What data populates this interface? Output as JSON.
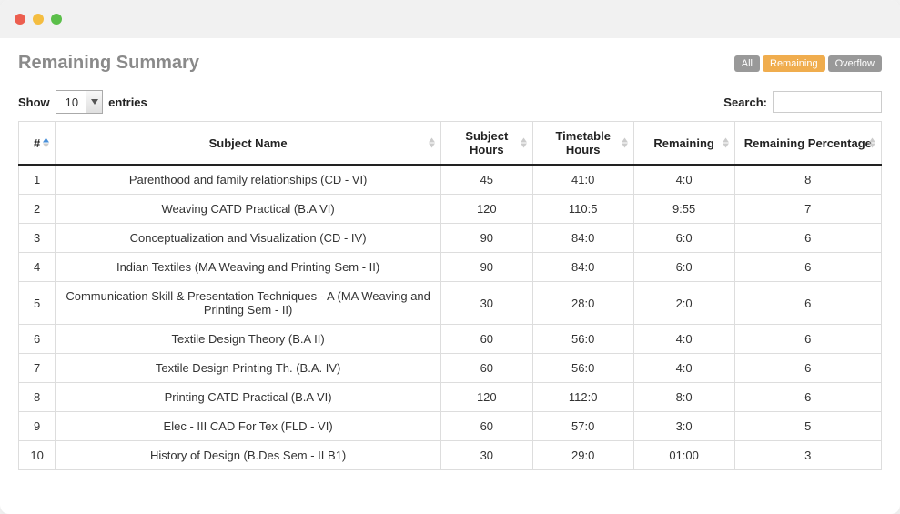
{
  "header": {
    "title": "Remaining Summary",
    "filters": {
      "all": "All",
      "remaining": "Remaining",
      "overflow": "Overflow"
    }
  },
  "controls": {
    "show_label": "Show",
    "entries_label": "entries",
    "entries_value": "10",
    "search_label": "Search:",
    "search_value": ""
  },
  "table": {
    "columns": {
      "num": "#",
      "subject": "Subject Name",
      "subject_hours": "Subject Hours",
      "timetable_hours": "Timetable Hours",
      "remaining": "Remaining",
      "remaining_pct": "Remaining Percentage"
    },
    "rows": [
      {
        "num": "1",
        "subject": "Parenthood and family relationships (CD - VI)",
        "subject_hours": "45",
        "timetable_hours": "41:0",
        "remaining": "4:0",
        "pct": "8"
      },
      {
        "num": "2",
        "subject": "Weaving CATD Practical (B.A VI)",
        "subject_hours": "120",
        "timetable_hours": "110:5",
        "remaining": "9:55",
        "pct": "7"
      },
      {
        "num": "3",
        "subject": "Conceptualization and Visualization (CD - IV)",
        "subject_hours": "90",
        "timetable_hours": "84:0",
        "remaining": "6:0",
        "pct": "6"
      },
      {
        "num": "4",
        "subject": "Indian Textiles (MA Weaving and Printing Sem - II)",
        "subject_hours": "90",
        "timetable_hours": "84:0",
        "remaining": "6:0",
        "pct": "6"
      },
      {
        "num": "5",
        "subject": "Communication Skill & Presentation Techniques - A (MA Weaving and Printing Sem - II)",
        "subject_hours": "30",
        "timetable_hours": "28:0",
        "remaining": "2:0",
        "pct": "6"
      },
      {
        "num": "6",
        "subject": "Textile Design Theory (B.A II)",
        "subject_hours": "60",
        "timetable_hours": "56:0",
        "remaining": "4:0",
        "pct": "6"
      },
      {
        "num": "7",
        "subject": "Textile Design Printing Th. (B.A. IV)",
        "subject_hours": "60",
        "timetable_hours": "56:0",
        "remaining": "4:0",
        "pct": "6"
      },
      {
        "num": "8",
        "subject": "Printing CATD Practical (B.A VI)",
        "subject_hours": "120",
        "timetable_hours": "112:0",
        "remaining": "8:0",
        "pct": "6"
      },
      {
        "num": "9",
        "subject": "Elec - III CAD For Tex (FLD - VI)",
        "subject_hours": "60",
        "timetable_hours": "57:0",
        "remaining": "3:0",
        "pct": "5"
      },
      {
        "num": "10",
        "subject": "History of Design (B.Des Sem - II B1)",
        "subject_hours": "30",
        "timetable_hours": "29:0",
        "remaining": "01:00",
        "pct": "3"
      }
    ]
  }
}
